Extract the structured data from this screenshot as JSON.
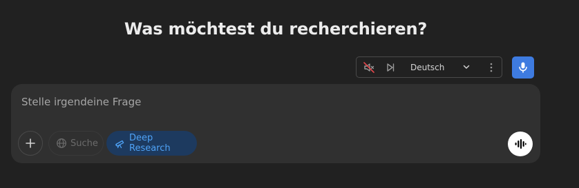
{
  "header": {
    "title": "Was möchtest du recherchieren?"
  },
  "voice_toolbar": {
    "mute_icon": "speaker-muted-icon",
    "skip_icon": "skip-forward-icon",
    "language": "Deutsch",
    "chevron_icon": "chevron-down-icon",
    "more_icon": "more-vertical-icon",
    "mic_icon": "microphone-icon",
    "mic_color": "#3e7be0"
  },
  "composer": {
    "placeholder": "Stelle irgendeine Frage",
    "plus_icon": "plus-icon",
    "search_label": "Suche",
    "search_icon": "globe-icon",
    "research_label": "Deep Research",
    "research_icon": "telescope-icon",
    "research_color": "#4fa3f7",
    "voice_mode_icon": "voice-waveform-icon"
  }
}
